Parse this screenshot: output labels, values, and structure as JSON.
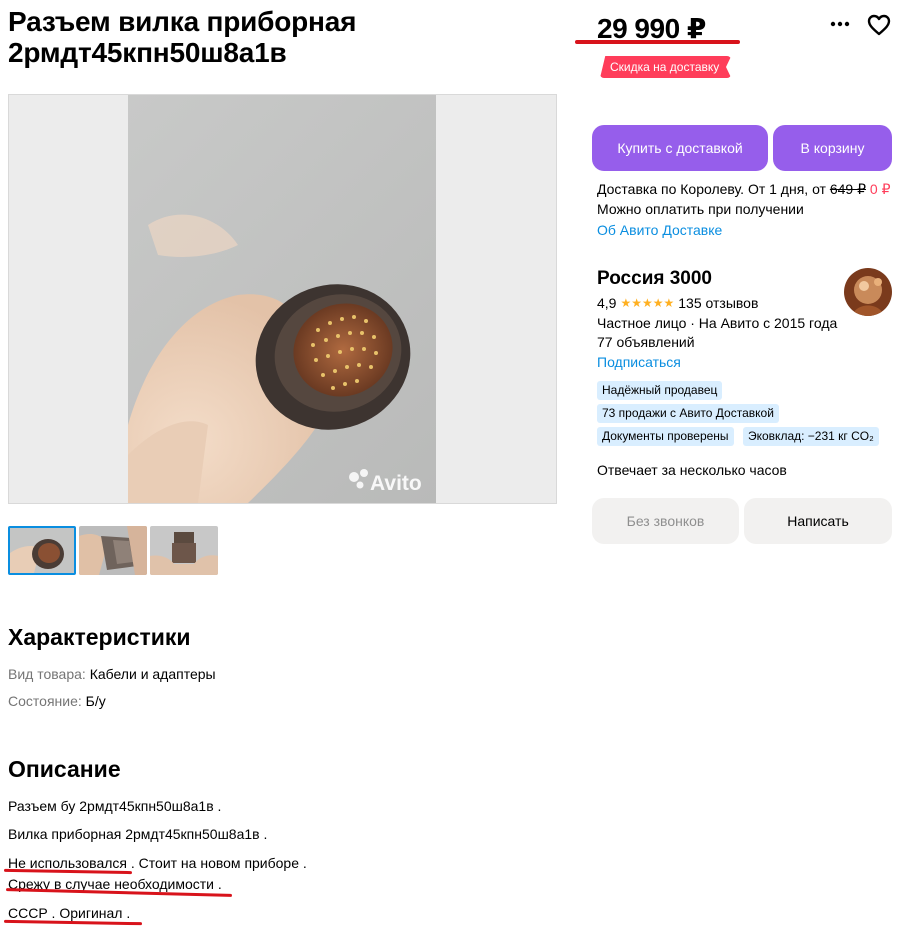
{
  "listing": {
    "title": "Разъем вилка приборная 2рмдт45кпн50ш8а1в",
    "price": "29 990 ₽",
    "delivery_badge": "Скидка на доставку",
    "gallery": {
      "watermark": "Avito",
      "thumbnail_count": 3
    }
  },
  "actions": {
    "buy_with_delivery": "Купить с доставкой",
    "add_to_cart": "В корзину",
    "no_calls": "Без звонков",
    "write": "Написать"
  },
  "delivery": {
    "line1_prefix": "Доставка по Королеву. От 1 дня, от ",
    "old_price": "649 ₽",
    "new_price": "0 ₽",
    "line2": "Можно оплатить при получении",
    "link": "Об Авито Доставке"
  },
  "seller": {
    "name": "Россия 3000",
    "rating": "4,9",
    "stars": 5,
    "reviews": "135 отзывов",
    "info": "Частное лицо · На Авито с 2015 года",
    "ads": "77 объявлений",
    "subscribe": "Подписаться",
    "tags": [
      "Надёжный продавец",
      "73 продажи с Авито Доставкой",
      "Документы проверены",
      "Эковклад: −231 кг CO₂"
    ],
    "response": "Отвечает за несколько часов"
  },
  "characteristics": {
    "heading": "Характеристики",
    "items": [
      {
        "key": "Вид товара:",
        "value": "Кабели и адаптеры"
      },
      {
        "key": "Состояние:",
        "value": "Б/у"
      }
    ]
  },
  "description": {
    "heading": "Описание",
    "lines": [
      "Разъем бу 2рмдт45кпн50ш8а1в .",
      "Вилка приборная 2рмдт45кпн50ш8а1в .",
      "Не использовался . Стоит на новом приборе .",
      "Срежу в случае необходимости .",
      "СССР . Оригинал ."
    ]
  },
  "colors": {
    "accent": "#965eeb",
    "annotation_red": "#d8131b",
    "badge": "#ff3d5a",
    "link": "#0a8ee0",
    "tag_bg": "#d9eeff"
  }
}
